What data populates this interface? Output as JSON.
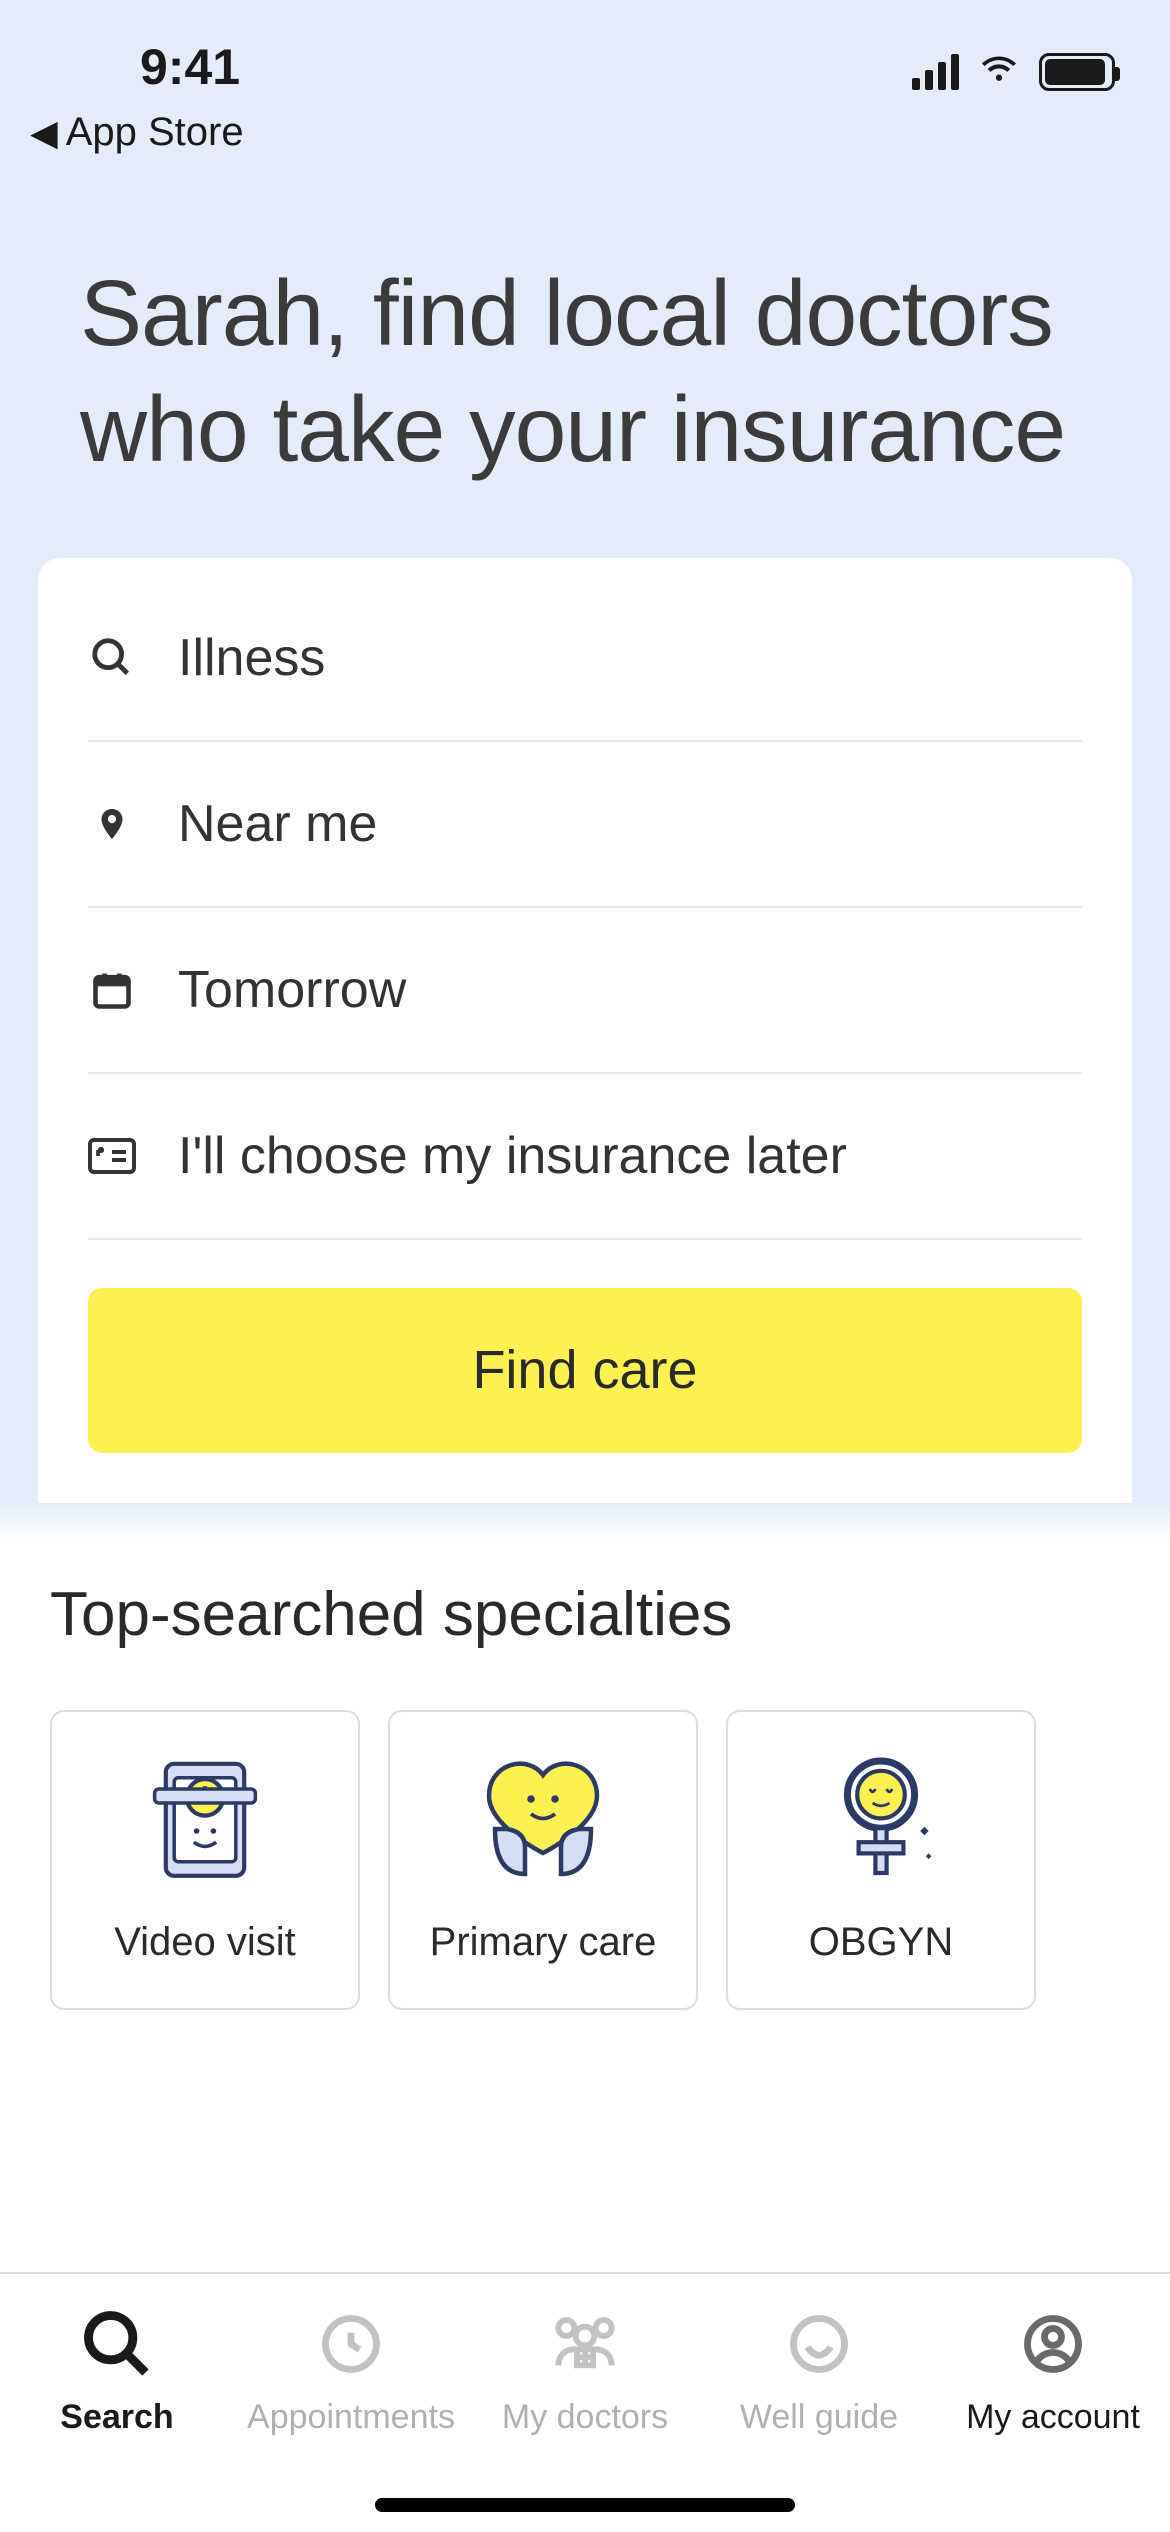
{
  "statusbar": {
    "time": "9:41"
  },
  "back": {
    "label": "App Store"
  },
  "hero": {
    "title": "Sarah, find local doctors who take your insurance"
  },
  "search": {
    "condition": "Illness",
    "location": "Near me",
    "date": "Tomorrow",
    "insurance": "I'll choose my insurance later",
    "cta": "Find care"
  },
  "topSearched": {
    "heading": "Top-searched specialties",
    "items": [
      {
        "label": "Video visit"
      },
      {
        "label": "Primary care"
      },
      {
        "label": "OBGYN"
      }
    ]
  },
  "tabs": {
    "search": "Search",
    "appointments": "Appointments",
    "mydoctors": "My doctors",
    "wellguide": "Well guide",
    "myaccount": "My account"
  }
}
